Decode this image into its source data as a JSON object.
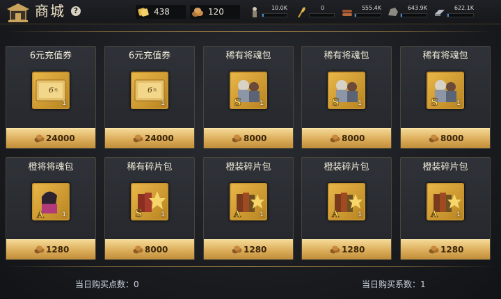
{
  "header": {
    "title": "商城",
    "help": "?",
    "currency1": "438",
    "currency2": "120",
    "resources": [
      {
        "name": "soldiers",
        "value": "10.0K",
        "fill": 0.05
      },
      {
        "name": "grain",
        "value": "0",
        "fill": 0.0
      },
      {
        "name": "wood",
        "value": "555.4K",
        "fill": 0.06
      },
      {
        "name": "stone",
        "value": "643.9K",
        "fill": 0.06
      },
      {
        "name": "iron",
        "value": "622.1K",
        "fill": 0.06
      }
    ]
  },
  "items": [
    {
      "name": "6元充值券",
      "price": "24000",
      "qty": "1",
      "icon": "coupon-icon"
    },
    {
      "name": "6元充值券",
      "price": "24000",
      "qty": "1",
      "icon": "coupon-icon"
    },
    {
      "name": "稀有将魂包",
      "price": "8000",
      "qty": "1",
      "icon": "general-soul-pack-icon"
    },
    {
      "name": "稀有将魂包",
      "price": "8000",
      "qty": "1",
      "icon": "general-soul-pack-icon"
    },
    {
      "name": "稀有将魂包",
      "price": "8000",
      "qty": "1",
      "icon": "general-soul-pack-icon"
    },
    {
      "name": "橙将将魂包",
      "price": "1280",
      "qty": "1",
      "icon": "orange-general-pack-icon"
    },
    {
      "name": "稀有碎片包",
      "price": "8000",
      "qty": "1",
      "icon": "shard-pack-icon"
    },
    {
      "name": "橙装碎片包",
      "price": "1280",
      "qty": "1",
      "icon": "orange-equip-pack-icon"
    },
    {
      "name": "橙装碎片包",
      "price": "1280",
      "qty": "1",
      "icon": "orange-equip-pack-icon"
    },
    {
      "name": "橙装碎片包",
      "price": "1280",
      "qty": "1",
      "icon": "orange-equip-pack-icon"
    }
  ],
  "footer": {
    "points_label": "当日购买点数：",
    "points_value": "0",
    "factor_label": "当日购买系数：",
    "factor_value": "1"
  },
  "colors": {
    "accent": "#c7942f",
    "price_bg": "#d9a955"
  }
}
